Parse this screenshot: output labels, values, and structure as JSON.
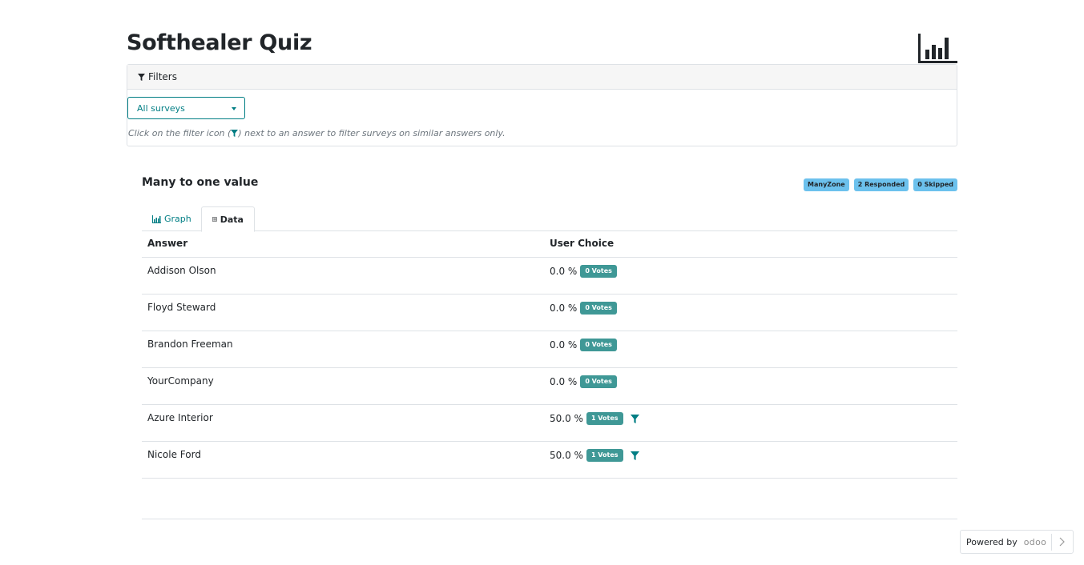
{
  "page": {
    "title": "Softhealer Quiz"
  },
  "filters": {
    "header_label": "Filters",
    "select_value": "All surveys",
    "hint_before": "Click on the filter icon (",
    "hint_after": ") next to an answer to filter surveys on similar answers only."
  },
  "question": {
    "title": "Many to one value",
    "badges": [
      "ManyZone",
      "2 Responded",
      "0 Skipped"
    ]
  },
  "tabs": {
    "graph_label": "Graph",
    "data_label": "Data"
  },
  "table": {
    "headers": [
      "Answer",
      "User Choice"
    ],
    "rows": [
      {
        "answer": "Addison Olson",
        "percent": "0.0 %",
        "votes": "0 Votes",
        "filter": false
      },
      {
        "answer": "Floyd Steward",
        "percent": "0.0 %",
        "votes": "0 Votes",
        "filter": false
      },
      {
        "answer": "Brandon Freeman",
        "percent": "0.0 %",
        "votes": "0 Votes",
        "filter": false
      },
      {
        "answer": "YourCompany",
        "percent": "0.0 %",
        "votes": "0 Votes",
        "filter": false
      },
      {
        "answer": "Azure Interior",
        "percent": "50.0 %",
        "votes": "1 Votes",
        "filter": true
      },
      {
        "answer": "Nicole Ford",
        "percent": "50.0 %",
        "votes": "1 Votes",
        "filter": true
      }
    ]
  },
  "footer": {
    "powered_by": "Powered by",
    "brand": "odoo"
  },
  "colors": {
    "accent": "#017e84",
    "badge_info": "#6cc1ed",
    "votes_badge": "#3f9896"
  },
  "icons": {
    "logo": "bar-chart-icon",
    "filters": "filter-icon",
    "graph_tab": "bar-chart-icon",
    "data_tab": "list-alt-icon",
    "row_filter": "filter-icon",
    "powered_chevron": "chevron-right-icon"
  }
}
